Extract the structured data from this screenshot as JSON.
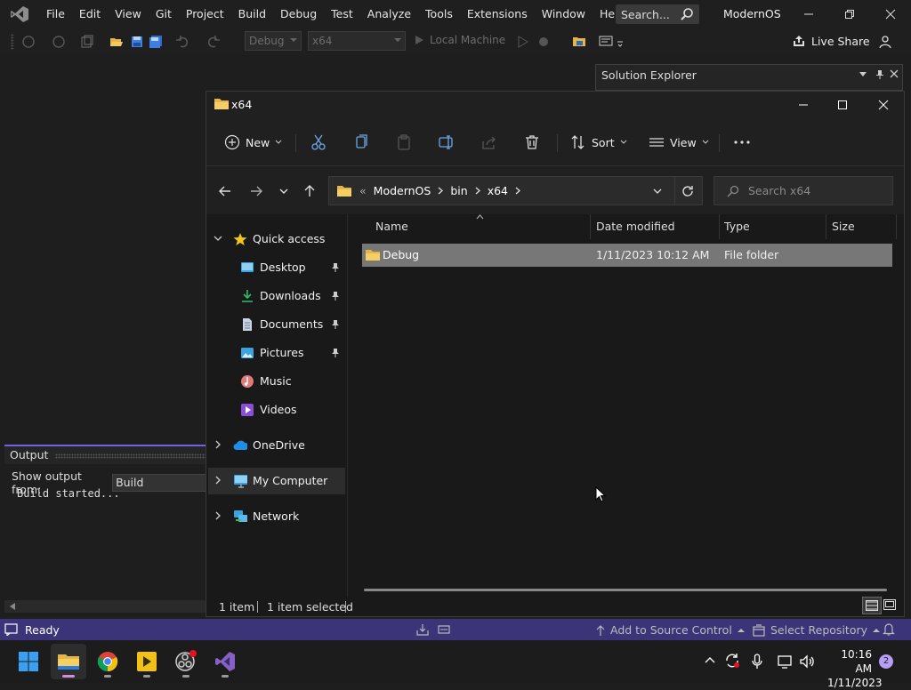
{
  "vs": {
    "menu": [
      "File",
      "Edit",
      "View",
      "Git",
      "Project",
      "Build",
      "Debug",
      "Test",
      "Analyze",
      "Tools",
      "Extensions",
      "Window",
      "Help"
    ],
    "search_label": "Search...",
    "solution_name": "ModernOS",
    "toolbar": {
      "config": "Debug",
      "platform": "x64",
      "run_target": "Local Machine",
      "live_share": "Live Share"
    },
    "solution_explorer_title": "Solution Explorer",
    "output": {
      "title": "Output",
      "show_from_label": "Show output from:",
      "show_from_value": "Build",
      "text": "Build started..."
    },
    "status": {
      "state": "Ready",
      "add_source_control": "Add to Source Control",
      "select_repo": "Select Repository"
    }
  },
  "explorer": {
    "title": "x64",
    "commands": {
      "new": "New",
      "sort": "Sort",
      "view": "View"
    },
    "breadcrumb": [
      "ModernOS",
      "bin",
      "x64"
    ],
    "breadcrumb_overflow": "«",
    "search_placeholder": "Search x64",
    "nav": {
      "quick_access": "Quick access",
      "desktop": "Desktop",
      "downloads": "Downloads",
      "documents": "Documents",
      "pictures": "Pictures",
      "music": "Music",
      "videos": "Videos",
      "onedrive": "OneDrive",
      "my_computer": "My Computer",
      "network": "Network"
    },
    "columns": {
      "name": "Name",
      "date": "Date modified",
      "type": "Type",
      "size": "Size"
    },
    "files": [
      {
        "name": "Debug",
        "date": "1/11/2023 10:12 AM",
        "type": "File folder",
        "size": ""
      }
    ],
    "status": {
      "count": "1 item",
      "selected": "1 item selected"
    }
  },
  "taskbar": {
    "time": "10:16 AM",
    "date": "1/11/2023",
    "notification_count": "2"
  },
  "colors": {
    "accent": "#7160e8",
    "status_bar": "#3c3478",
    "selection": "#777777",
    "folder": "#f2c14e"
  }
}
